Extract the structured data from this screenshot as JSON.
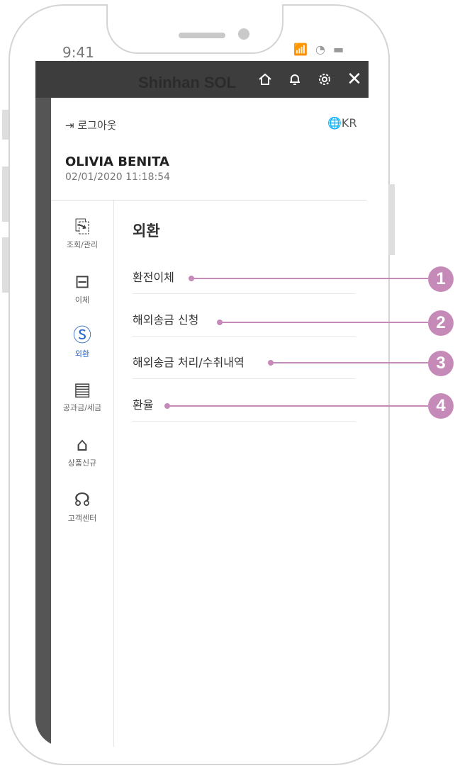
{
  "status_bar": {
    "time": "9:41",
    "icons": "📶 ◔ ▬"
  },
  "header": {
    "brand": "Shinhan SOL",
    "home_icon": "home-icon",
    "bell_icon": "bell-icon",
    "settings_icon": "gear-icon",
    "close_label": "✕"
  },
  "account": {
    "logout_label": "로그아웃",
    "language_label": "KR",
    "user_name": "OLIVIA BENITA",
    "last_login": "02/01/2020 11:18:54"
  },
  "sidebar": {
    "items": [
      {
        "label": "조회/관리",
        "icon": "search-document-icon"
      },
      {
        "label": "이체",
        "icon": "transfer-icon"
      },
      {
        "label": "외환",
        "icon": "currency-exchange-icon"
      },
      {
        "label": "공과금/세금",
        "icon": "bill-icon"
      },
      {
        "label": "상품신규",
        "icon": "shopping-bag-icon"
      },
      {
        "label": "고객센터",
        "icon": "headset-icon"
      }
    ],
    "active": "외환"
  },
  "section": {
    "title": "외환",
    "items": [
      {
        "label": "환전이체",
        "badge": "1"
      },
      {
        "label": "해외송금 신청",
        "badge": "2"
      },
      {
        "label": "해외송금 처리/수취내역",
        "badge": "3"
      },
      {
        "label": "환율",
        "badge": "4"
      }
    ]
  },
  "colors": {
    "callout": "#c58ab8",
    "active_nav": "#2566c9",
    "topbar": "#3d3d3d"
  }
}
